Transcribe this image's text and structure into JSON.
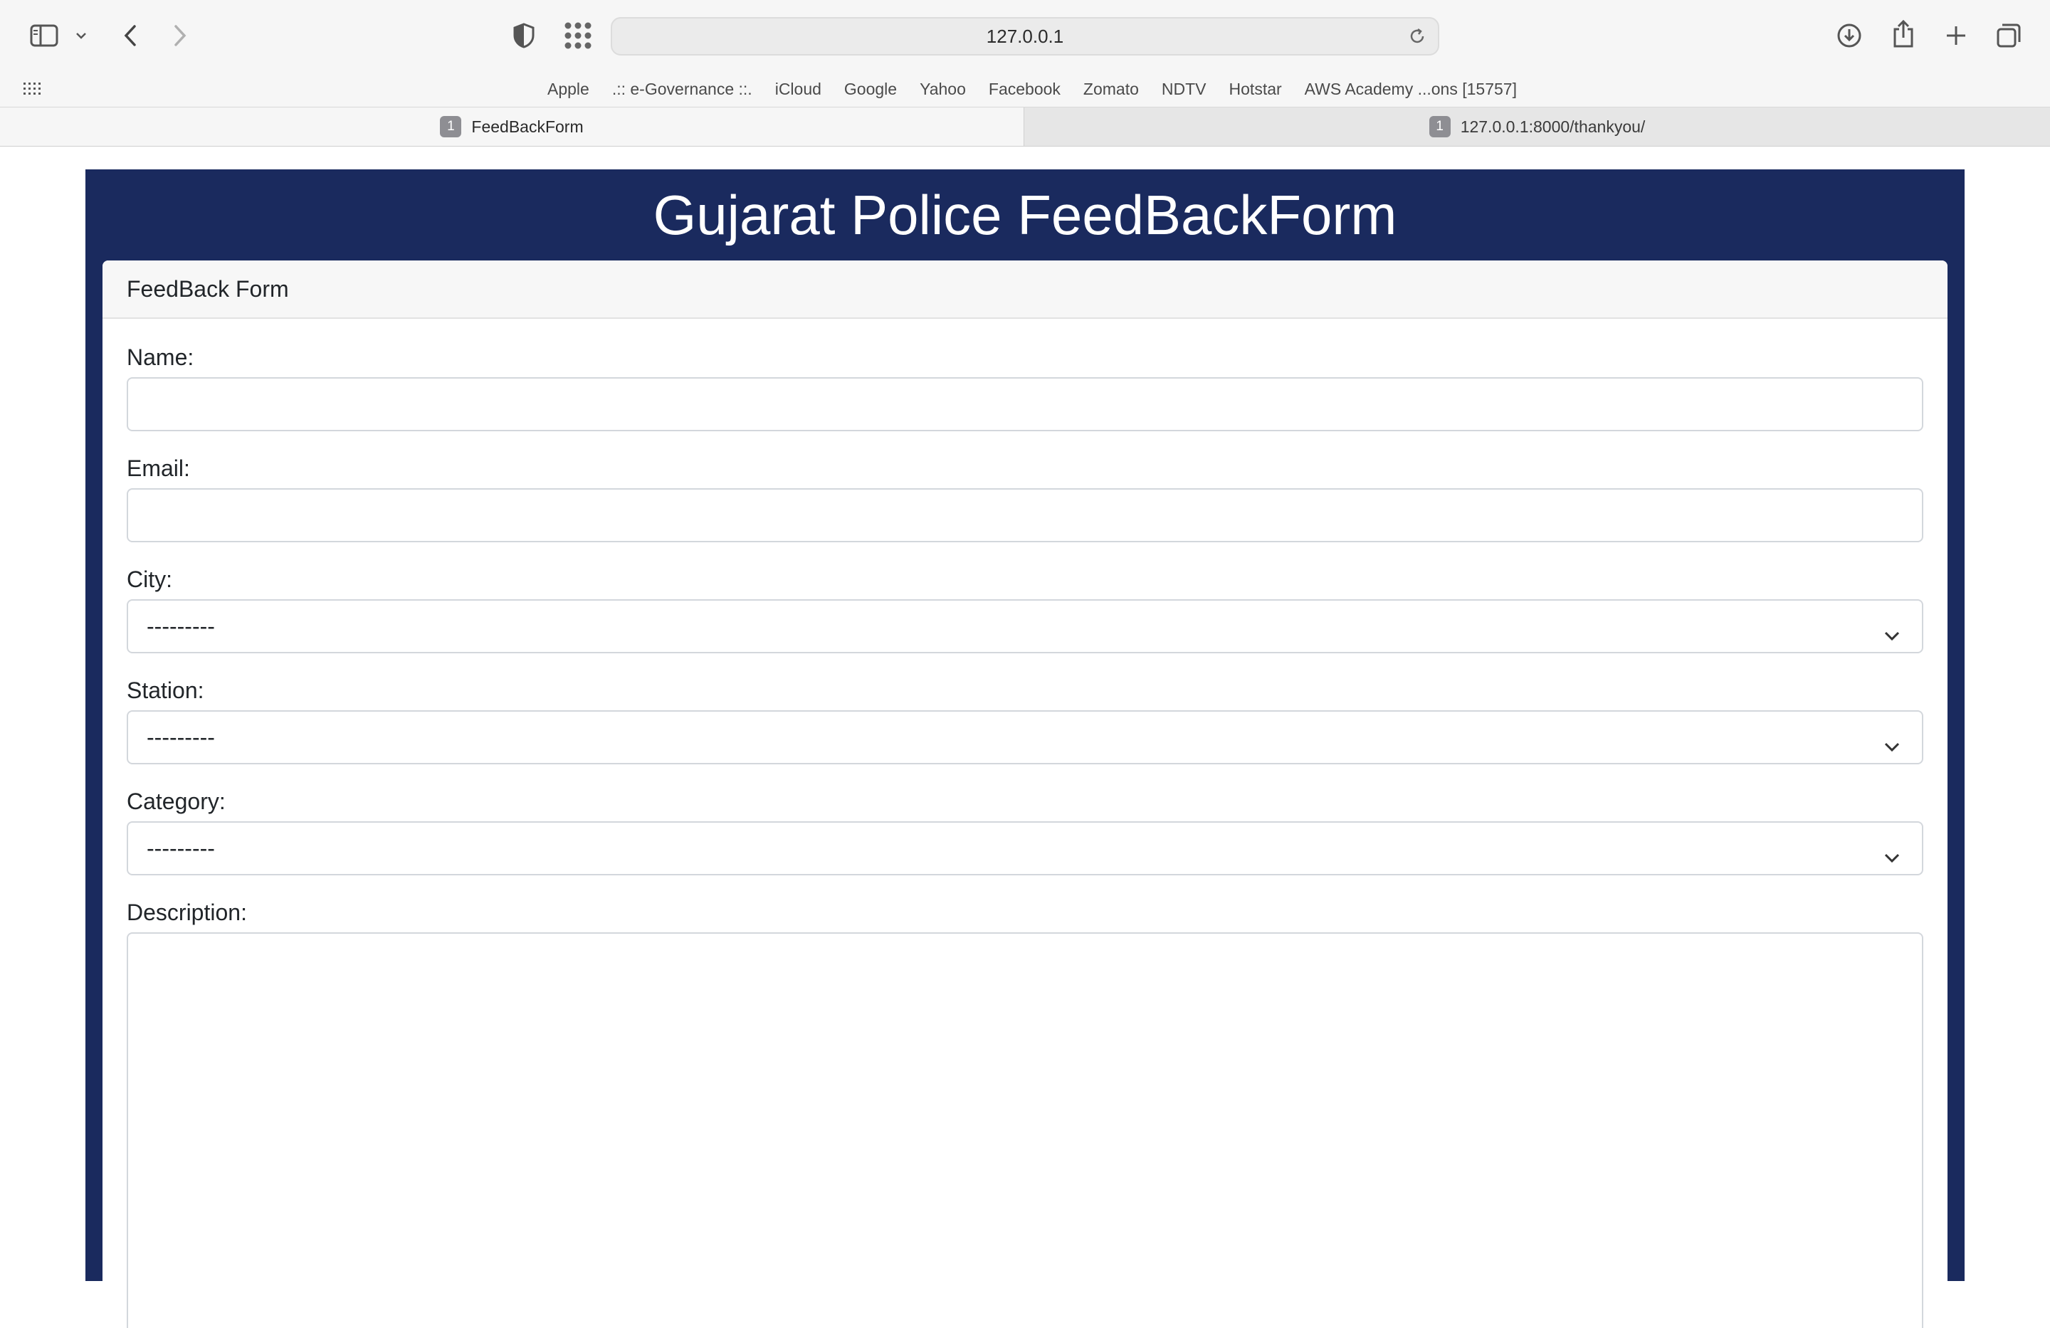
{
  "browser": {
    "address": "127.0.0.1",
    "favorites": [
      "Apple",
      ".:: e-Governance ::.",
      "iCloud",
      "Google",
      "Yahoo",
      "Facebook",
      "Zomato",
      "NDTV",
      "Hotstar",
      "AWS Academy ...ons [15757]"
    ],
    "tabs": [
      {
        "label": "FeedBackForm",
        "badge": "1"
      },
      {
        "label": "127.0.0.1:8000/thankyou/",
        "badge": "1"
      }
    ]
  },
  "page": {
    "title": "Gujarat Police FeedBackForm",
    "card_header": "FeedBack Form",
    "fields": {
      "name_label": "Name:",
      "name_value": "",
      "email_label": "Email:",
      "email_value": "",
      "city_label": "City:",
      "city_value": "---------",
      "station_label": "Station:",
      "station_value": "---------",
      "category_label": "Category:",
      "category_value": "---------",
      "description_label": "Description:",
      "description_value": ""
    }
  },
  "colors": {
    "header_bg": "#1a2a5e",
    "chrome_bg": "#f6f6f6"
  }
}
